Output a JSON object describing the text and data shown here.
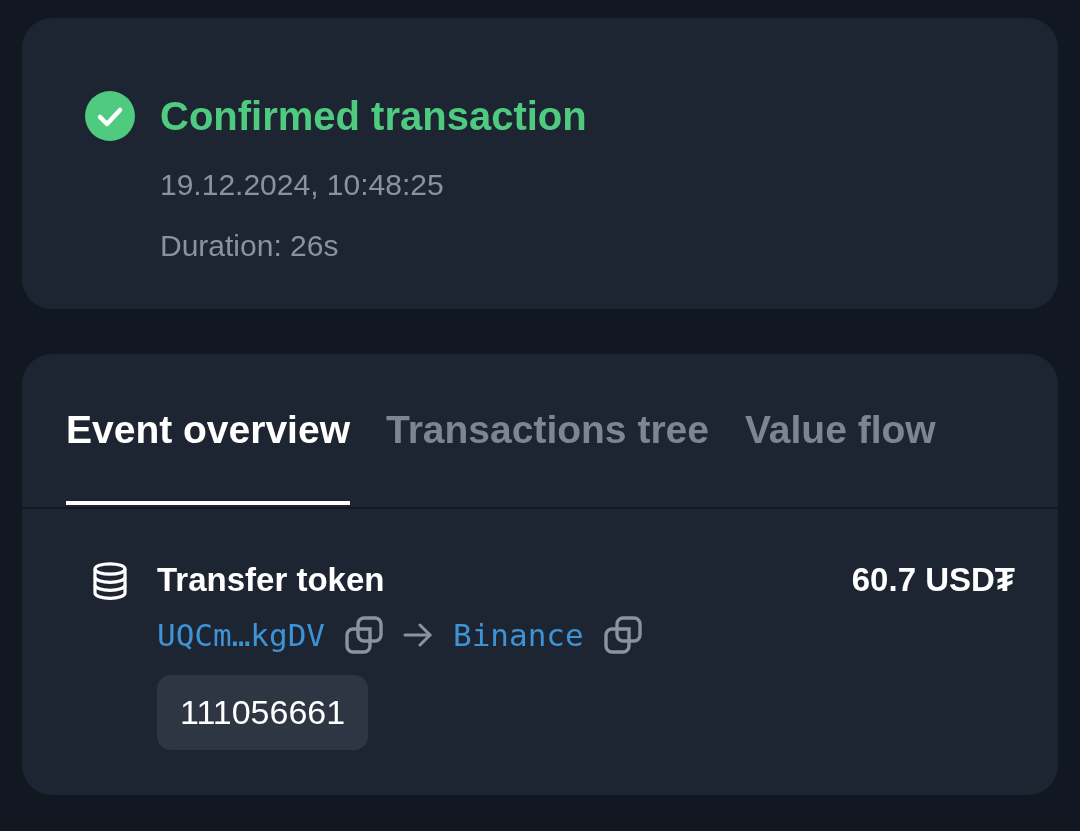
{
  "status": {
    "kind": "confirmed",
    "title": "Confirmed transaction",
    "timestamp": "19.12.2024, 10:48:25",
    "duration": "Duration: 26s"
  },
  "tabs": [
    {
      "label": "Event overview",
      "selected": true
    },
    {
      "label": "Transactions tree",
      "selected": false
    },
    {
      "label": "Value flow",
      "selected": false
    }
  ],
  "events": [
    {
      "kind": "transfer",
      "title": "Transfer token",
      "amount": "60.7 USD₮",
      "from": "UQCm…kgDV",
      "to": "Binance",
      "badge": "111056661"
    }
  ]
}
